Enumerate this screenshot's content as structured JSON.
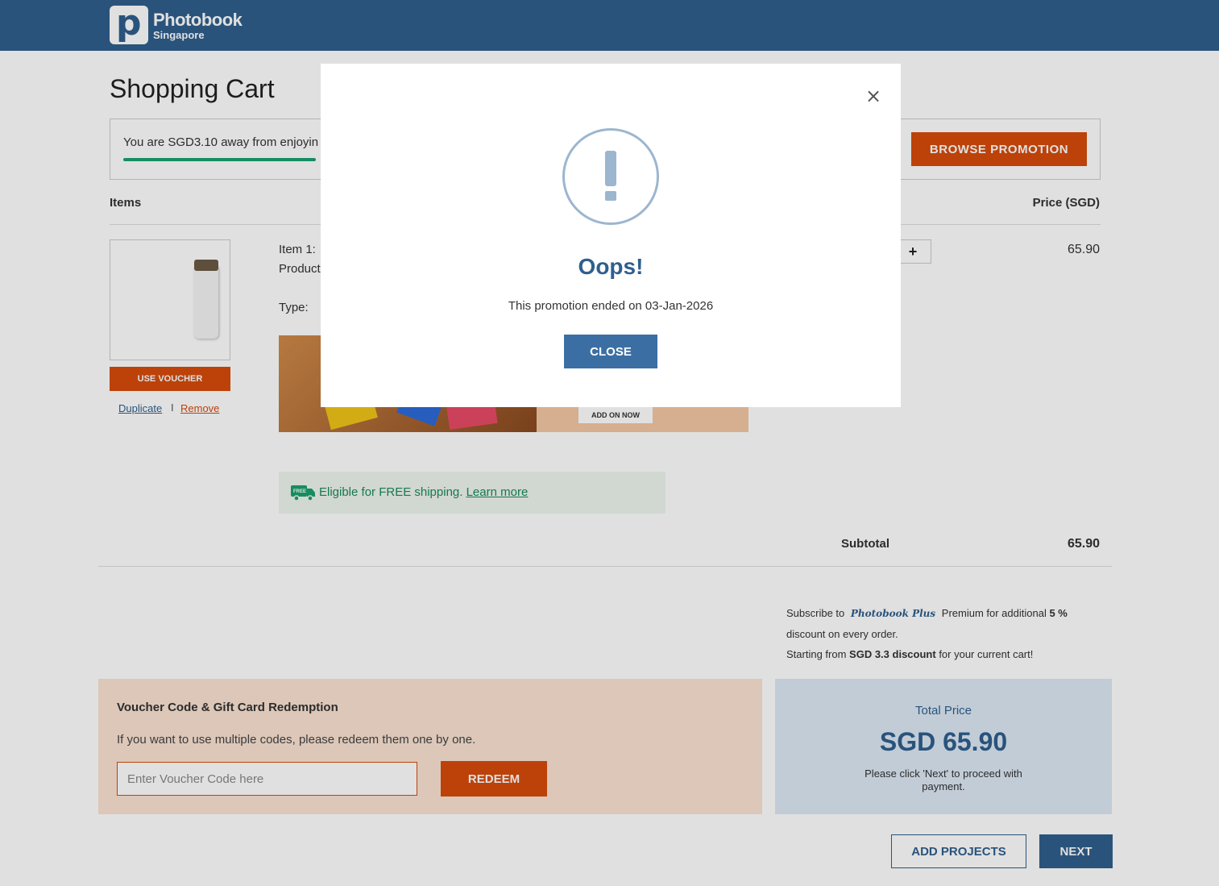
{
  "header": {
    "brand": "Photobook",
    "region": "Singapore",
    "logo_letter": "p"
  },
  "page": {
    "title": "Shopping Cart"
  },
  "promo": {
    "text": "You are SGD3.10 away from enjoyin",
    "button": "BROWSE PROMOTION",
    "progress_fraction": 0.2
  },
  "table": {
    "items_header": "Items",
    "price_header": "Price (SGD)"
  },
  "item": {
    "use_voucher": "USE VOUCHER",
    "duplicate": "Duplicate",
    "separator": "I",
    "remove": "Remove",
    "label": "Item 1:",
    "product_label": "Product",
    "type_label": "Type:",
    "qty_plus": "+",
    "price": "65.90",
    "addon_button": "ADD ON NOW"
  },
  "shipping": {
    "badge": "FREE",
    "text": "Eligible for FREE shipping.",
    "link": "Learn more"
  },
  "subtotal": {
    "label": "Subtotal",
    "value": "65.90"
  },
  "premium": {
    "prefix": "Subscribe to",
    "logo": "Photobook Plus",
    "middle": "Premium for additional",
    "percent": "5 %",
    "line2": "discount on every order.",
    "line3_prefix": "Starting from",
    "line3_bold": "SGD 3.3 discount",
    "line3_suffix": "for your current cart!"
  },
  "voucher": {
    "title": "Voucher Code & Gift Card Redemption",
    "hint": "If you want to use multiple codes, please redeem them one by one.",
    "placeholder": "Enter Voucher Code here",
    "value": "",
    "redeem": "REDEEM"
  },
  "total": {
    "label": "Total Price",
    "value": "SGD 65.90",
    "note": "Please click 'Next' to proceed with payment."
  },
  "actions": {
    "add_projects": "ADD PROJECTS",
    "next": "NEXT"
  },
  "modal": {
    "close_x": "×",
    "title": "Oops!",
    "message": "This promotion ended on 03-Jan-2026",
    "close_button": "CLOSE"
  },
  "colors": {
    "header_blue": "#2f5f8d",
    "accent_orange": "#d64c0c",
    "success_green": "#1aa16f"
  },
  "icons": {
    "alert": "exclamation-circle-icon",
    "truck": "delivery-truck-icon",
    "close": "close-icon"
  }
}
